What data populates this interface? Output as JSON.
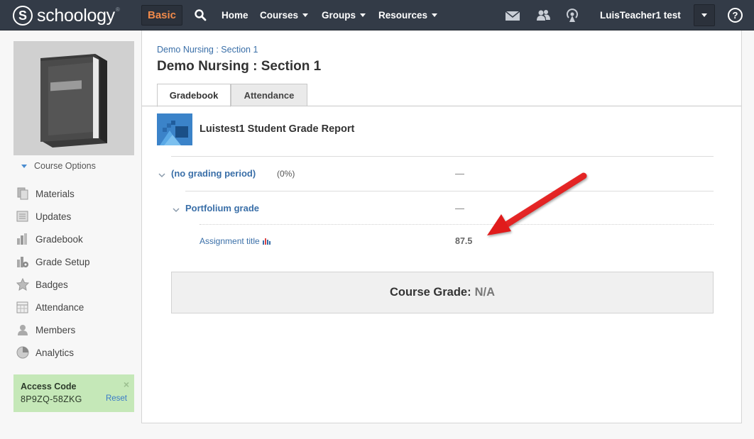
{
  "topbar": {
    "logo_text": "schoology",
    "logo_letter": "S",
    "logo_tm": "®",
    "basic_label": "Basic",
    "nav": [
      {
        "label": "Home",
        "has_caret": false
      },
      {
        "label": "Courses",
        "has_caret": true
      },
      {
        "label": "Groups",
        "has_caret": true
      },
      {
        "label": "Resources",
        "has_caret": true
      }
    ],
    "user_name": "LuisTeacher1 test",
    "help_label": "?"
  },
  "sidebar": {
    "course_options_label": "Course Options",
    "items": [
      {
        "label": "Materials",
        "icon": "materials-icon"
      },
      {
        "label": "Updates",
        "icon": "updates-icon"
      },
      {
        "label": "Gradebook",
        "icon": "gradebook-icon"
      },
      {
        "label": "Grade Setup",
        "icon": "grade-setup-icon"
      },
      {
        "label": "Badges",
        "icon": "badges-icon"
      },
      {
        "label": "Attendance",
        "icon": "attendance-icon"
      },
      {
        "label": "Members",
        "icon": "members-icon"
      },
      {
        "label": "Analytics",
        "icon": "analytics-icon"
      }
    ],
    "access_code": {
      "title": "Access Code",
      "code": "8P9ZQ-58ZKG",
      "reset_label": "Reset",
      "close_label": "×"
    }
  },
  "main": {
    "breadcrumb": "Demo Nursing : Section 1",
    "title": "Demo Nursing : Section 1",
    "tabs": [
      {
        "label": "Gradebook",
        "active": true
      },
      {
        "label": "Attendance",
        "active": false
      }
    ],
    "report_title": "Luistest1 Student Grade Report",
    "grading_period": {
      "label": "(no grading period)",
      "percent": "(0%)",
      "grade": "—"
    },
    "category": {
      "label": "Portfolium grade",
      "grade": "—"
    },
    "assignment": {
      "label": "Assignment title",
      "grade": "87.5"
    },
    "course_grade": {
      "label": "Course Grade:",
      "value": "N/A"
    }
  },
  "colors": {
    "topbar": "#333b47",
    "accent_orange": "#f18a4a",
    "link_blue": "#3a6fa8",
    "access_green": "#c5e8b8",
    "arrow_red": "#e01b1b"
  }
}
